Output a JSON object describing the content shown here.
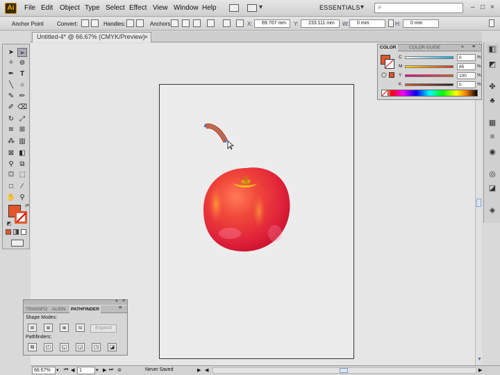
{
  "app": {
    "logo_text": "Ai"
  },
  "menu": {
    "items": [
      "File",
      "Edit",
      "Object",
      "Type",
      "Select",
      "Effect",
      "View",
      "Window",
      "Help"
    ],
    "workspace": "ESSENTIALS"
  },
  "control_bar": {
    "mode": "Anchor Point",
    "convert_label": "Convert:",
    "handles_label": "Handles:",
    "anchors_label": "Anchors:",
    "x_label": "X:",
    "x_value": "69.707 mm",
    "y_label": "Y:",
    "y_value": "233.111 mm",
    "w_label": "W:",
    "w_value": "0 mm",
    "h_label": "H:",
    "h_value": "0 mm"
  },
  "document": {
    "tab_title": "Untitled-4* @ 66.67% (CMYK/Preview)",
    "close_glyph": "×"
  },
  "color_panel": {
    "tabs": [
      "COLOR",
      "COLOR GUIDE"
    ],
    "sliders": [
      {
        "label": "C",
        "value": "0",
        "color_from": "#ffffff",
        "color_to": "#00aeef"
      },
      {
        "label": "M",
        "value": "85",
        "color_from": "#ffe000",
        "color_to": "#e0301e"
      },
      {
        "label": "Y",
        "value": "100",
        "color_from": "#ec008c",
        "color_to": "#e3552a"
      },
      {
        "label": "K",
        "value": "0",
        "color_from": "#e3552a",
        "color_to": "#231f20"
      }
    ],
    "percent": "%",
    "fill_color": "#e3552a"
  },
  "pathfinder_panel": {
    "tabs": [
      "TRANSFO",
      "ALIGN",
      "PATHFINDER"
    ],
    "shape_modes_label": "Shape Modes:",
    "pathfinders_label": "Pathfinders:",
    "expand_label": "Expand"
  },
  "status_bar": {
    "zoom": "66.67%",
    "artboard_number": "1",
    "status_text": "Never Saved"
  },
  "tools": {
    "fill_color": "#e3552a",
    "stroke_color": "#e3552a"
  }
}
